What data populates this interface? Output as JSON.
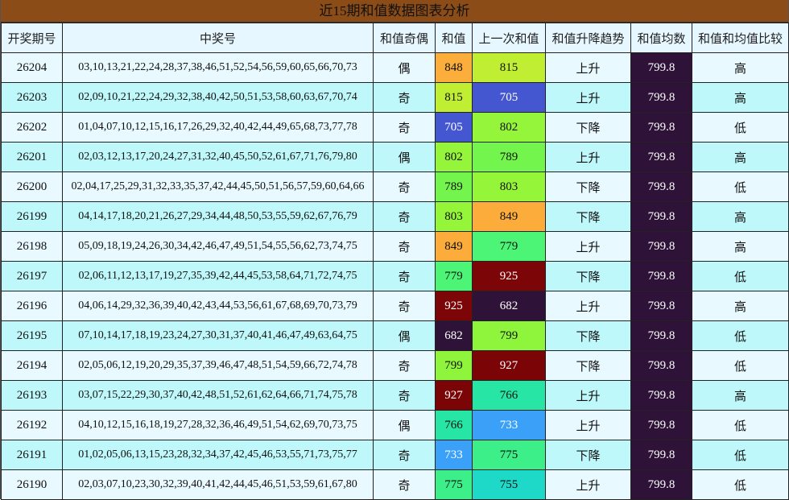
{
  "title": "近15期和值数据图表分析",
  "headers": [
    "开奖期号",
    "中奖号",
    "和值奇偶",
    "和值",
    "上一次和值",
    "和值升降趋势",
    "和值均数",
    "和值和均值比较"
  ],
  "rows": [
    {
      "issue": "26204",
      "numbers": "03,10,13,21,22,24,28,37,38,46,51,52,54,56,59,60,65,66,70,73",
      "parity": "偶",
      "sum": "848",
      "sum_color": "#fcae3c",
      "sum_text": "#111111",
      "prev": "815",
      "prev_color": "#c0ee32",
      "prev_text": "#111111",
      "trend": "上升",
      "avg": "799.8",
      "compare": "高"
    },
    {
      "issue": "26203",
      "numbers": "02,09,10,21,22,24,29,32,38,40,42,50,51,53,58,60,63,67,70,74",
      "parity": "奇",
      "sum": "815",
      "sum_color": "#c0ee32",
      "sum_text": "#111111",
      "prev": "705",
      "prev_color": "#4557d0",
      "prev_text": "#ffffff",
      "trend": "上升",
      "avg": "799.8",
      "compare": "高"
    },
    {
      "issue": "26202",
      "numbers": "01,04,07,10,12,15,16,17,26,29,32,40,42,44,49,65,68,73,77,78",
      "parity": "奇",
      "sum": "705",
      "sum_color": "#4557d0",
      "sum_text": "#ffffff",
      "prev": "802",
      "prev_color": "#94f53a",
      "prev_text": "#111111",
      "trend": "下降",
      "avg": "799.8",
      "compare": "低"
    },
    {
      "issue": "26201",
      "numbers": "02,03,12,13,17,20,24,27,31,32,40,45,50,52,61,67,71,76,79,80",
      "parity": "偶",
      "sum": "802",
      "sum_color": "#94f53a",
      "sum_text": "#111111",
      "prev": "789",
      "prev_color": "#74f54e",
      "prev_text": "#111111",
      "trend": "上升",
      "avg": "799.8",
      "compare": "高"
    },
    {
      "issue": "26200",
      "numbers": "02,04,17,25,29,31,32,33,35,37,42,44,45,50,51,56,57,59,60,64,66",
      "parity": "奇",
      "sum": "789",
      "sum_color": "#74f54e",
      "sum_text": "#111111",
      "prev": "803",
      "prev_color": "#95f538",
      "prev_text": "#111111",
      "trend": "下降",
      "avg": "799.8",
      "compare": "低"
    },
    {
      "issue": "26199",
      "numbers": "04,14,17,18,20,21,26,27,29,34,44,48,50,53,55,59,62,67,76,79",
      "parity": "奇",
      "sum": "803",
      "sum_color": "#95f538",
      "sum_text": "#111111",
      "prev": "849",
      "prev_color": "#fcac3b",
      "prev_text": "#111111",
      "trend": "下降",
      "avg": "799.8",
      "compare": "高"
    },
    {
      "issue": "26198",
      "numbers": "05,09,18,19,24,26,30,34,42,46,47,49,51,54,55,56,62,73,74,75",
      "parity": "奇",
      "sum": "849",
      "sum_color": "#fcac3b",
      "sum_text": "#111111",
      "prev": "779",
      "prev_color": "#4cf576",
      "prev_text": "#111111",
      "trend": "上升",
      "avg": "799.8",
      "compare": "高"
    },
    {
      "issue": "26197",
      "numbers": "02,06,11,12,13,17,19,27,35,39,42,44,45,53,58,64,71,72,74,75",
      "parity": "奇",
      "sum": "779",
      "sum_color": "#4cf576",
      "sum_text": "#111111",
      "prev": "925",
      "prev_color": "#7c0508",
      "prev_text": "#ffffff",
      "trend": "下降",
      "avg": "799.8",
      "compare": "低"
    },
    {
      "issue": "26196",
      "numbers": "04,06,14,29,32,36,39,40,42,43,44,53,56,61,67,68,69,70,73,79",
      "parity": "奇",
      "sum": "925",
      "sum_color": "#7c0508",
      "sum_text": "#ffffff",
      "prev": "682",
      "prev_color": "#2f1238",
      "prev_text": "#ffffff",
      "trend": "上升",
      "avg": "799.8",
      "compare": "高"
    },
    {
      "issue": "26195",
      "numbers": "07,10,14,17,18,19,23,24,27,30,31,37,40,41,46,47,49,63,64,75",
      "parity": "偶",
      "sum": "682",
      "sum_color": "#2f1238",
      "sum_text": "#ffffff",
      "prev": "799",
      "prev_color": "#8ff53c",
      "prev_text": "#111111",
      "trend": "下降",
      "avg": "799.8",
      "compare": "低"
    },
    {
      "issue": "26194",
      "numbers": "02,05,06,12,19,20,29,35,37,39,46,47,48,51,54,59,66,72,74,78",
      "parity": "奇",
      "sum": "799",
      "sum_color": "#8ff53c",
      "sum_text": "#111111",
      "prev": "927",
      "prev_color": "#7a0406",
      "prev_text": "#ffffff",
      "trend": "下降",
      "avg": "799.8",
      "compare": "低"
    },
    {
      "issue": "26193",
      "numbers": "03,07,15,22,29,30,37,40,42,48,51,52,61,62,64,66,71,74,75,78",
      "parity": "奇",
      "sum": "927",
      "sum_color": "#7a0406",
      "sum_text": "#ffffff",
      "prev": "766",
      "prev_color": "#27e5a4",
      "prev_text": "#111111",
      "trend": "上升",
      "avg": "799.8",
      "compare": "高"
    },
    {
      "issue": "26192",
      "numbers": "04,10,12,15,16,18,19,27,28,32,36,46,49,51,54,62,69,70,73,75",
      "parity": "偶",
      "sum": "766",
      "sum_color": "#27e5a4",
      "sum_text": "#111111",
      "prev": "733",
      "prev_color": "#3aa0f8",
      "prev_text": "#ffffff",
      "trend": "上升",
      "avg": "799.8",
      "compare": "低"
    },
    {
      "issue": "26191",
      "numbers": "01,02,05,06,13,15,23,28,32,34,37,42,45,46,53,55,71,73,75,77",
      "parity": "奇",
      "sum": "733",
      "sum_color": "#3aa0f8",
      "sum_text": "#ffffff",
      "prev": "775",
      "prev_color": "#3cef88",
      "prev_text": "#111111",
      "trend": "下降",
      "avg": "799.8",
      "compare": "低"
    },
    {
      "issue": "26190",
      "numbers": "02,03,07,10,23,30,32,39,40,41,42,44,45,46,51,53,59,61,67,80",
      "parity": "奇",
      "sum": "775",
      "sum_color": "#3cef88",
      "sum_text": "#111111",
      "prev": "755",
      "prev_color": "#1fd9c8",
      "prev_text": "#111111",
      "trend": "上升",
      "avg": "799.8",
      "compare": "低"
    }
  ]
}
